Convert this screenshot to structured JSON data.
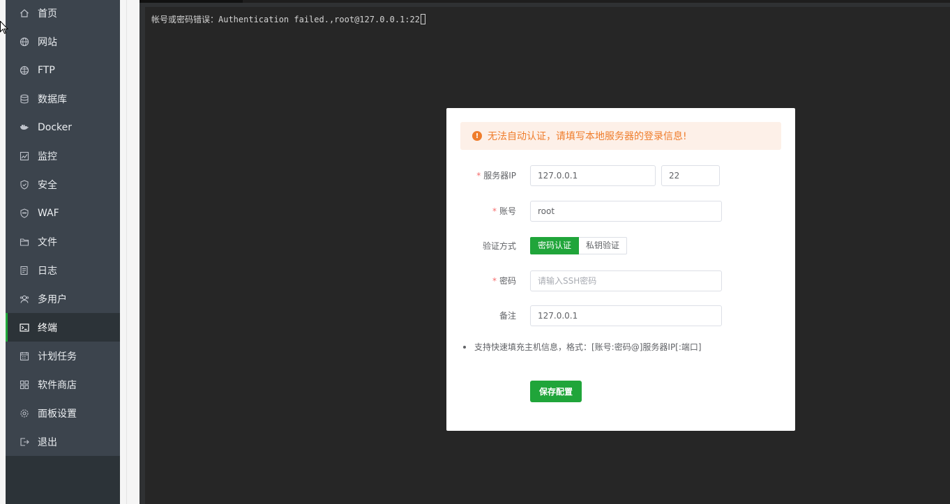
{
  "sidebar": {
    "items": [
      {
        "label": "首页",
        "icon": "home-icon"
      },
      {
        "label": "网站",
        "icon": "globe-icon"
      },
      {
        "label": "FTP",
        "icon": "ftp-globe-icon"
      },
      {
        "label": "数据库",
        "icon": "database-icon"
      },
      {
        "label": "Docker",
        "icon": "docker-icon"
      },
      {
        "label": "监控",
        "icon": "monitor-icon"
      },
      {
        "label": "安全",
        "icon": "shield-icon"
      },
      {
        "label": "WAF",
        "icon": "waf-shield-icon"
      },
      {
        "label": "文件",
        "icon": "folder-icon"
      },
      {
        "label": "日志",
        "icon": "log-icon"
      },
      {
        "label": "多用户",
        "icon": "users-icon"
      },
      {
        "label": "终端",
        "icon": "terminal-icon",
        "active": true
      },
      {
        "label": "计划任务",
        "icon": "calendar-icon"
      },
      {
        "label": "软件商店",
        "icon": "apps-icon"
      },
      {
        "label": "面板设置",
        "icon": "gear-icon"
      },
      {
        "label": "退出",
        "icon": "logout-icon"
      }
    ]
  },
  "terminal": {
    "output": "帐号或密码错误：Authentication failed.,root@127.0.0.1:22"
  },
  "dialog": {
    "alert": "无法自动认证，请填写本地服务器的登录信息!",
    "server_ip_label": "服务器IP",
    "server_ip": "127.0.0.1",
    "port": "22",
    "account_label": "账号",
    "account": "root",
    "auth_label": "验证方式",
    "auth_password": "密码认证",
    "auth_key": "私钥验证",
    "password_label": "密码",
    "password_placeholder": "请输入SSH密码",
    "remark_label": "备注",
    "remark": "127.0.0.1",
    "tip": "支持快速填充主机信息，格式：[账号:密码@]服务器IP[:端口]",
    "save_label": "保存配置"
  },
  "colors": {
    "accent": "#20a53a",
    "warning": "#ef7d2c",
    "sidebar_bg": "#3c444d",
    "terminal_bg": "#262626"
  }
}
